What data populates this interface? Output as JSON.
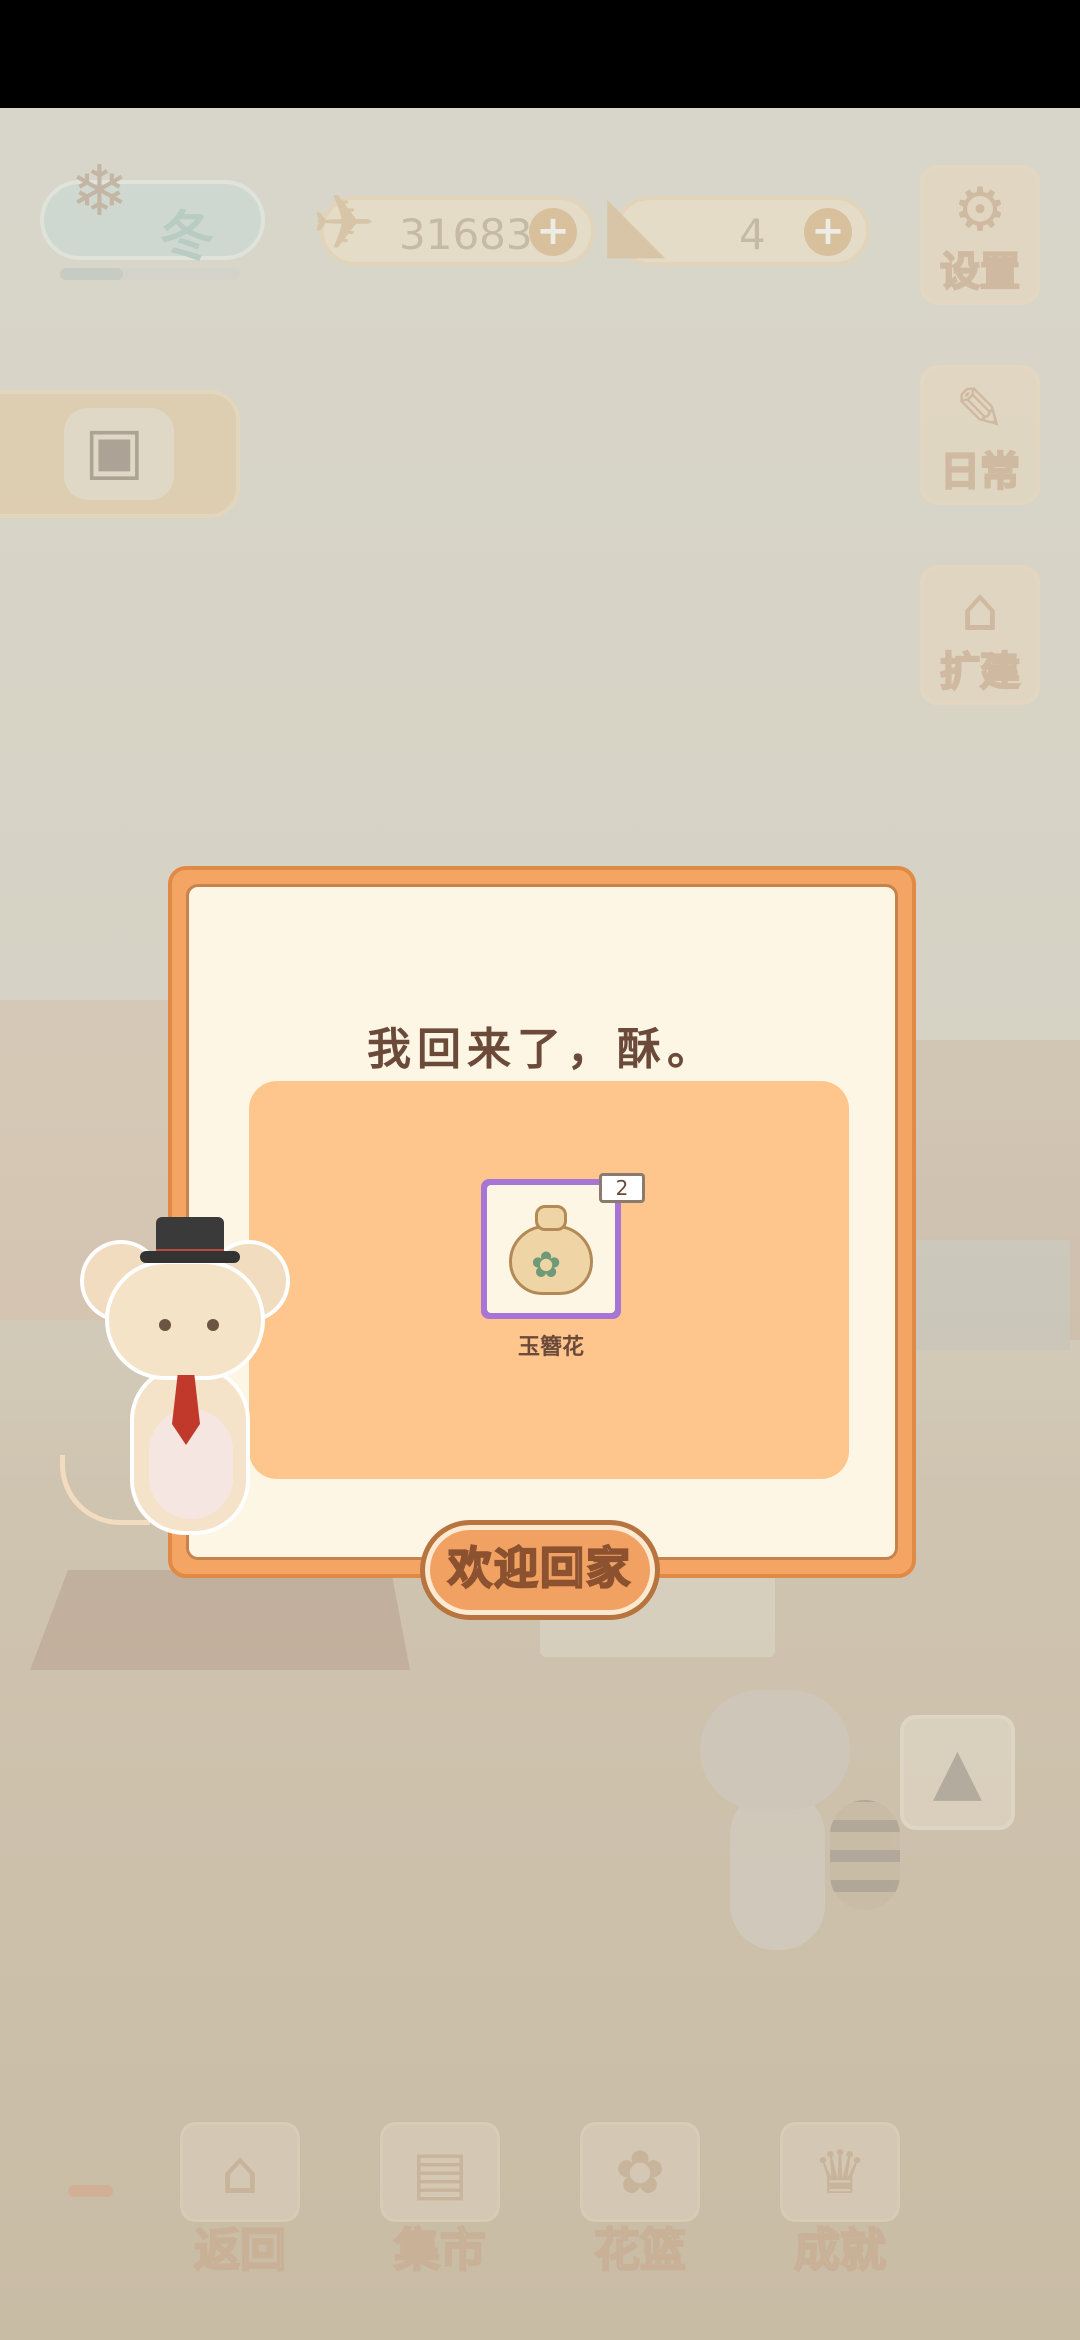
{
  "season": {
    "label": "冬",
    "progress": 0.35
  },
  "currencies": {
    "fish": "31683",
    "cheese": "4",
    "plus": "+"
  },
  "side_buttons": {
    "settings": "设置",
    "daily": "日常",
    "expand": "扩建"
  },
  "dialog": {
    "title": "我回来了，酥。",
    "reward": {
      "name": "玉簪花",
      "count": "2"
    },
    "confirm_label": "欢迎回家"
  },
  "bottom_nav": [
    {
      "label": "返回"
    },
    {
      "label": "集市"
    },
    {
      "label": "花篮"
    },
    {
      "label": "成就"
    }
  ],
  "icons": {
    "tree": "❄",
    "fish": "✈",
    "cheese": "◣",
    "settings": "⚙",
    "daily": "✎",
    "expand": "⌂",
    "bag": "▣",
    "map": "▲",
    "back": "⌂",
    "market": "▤",
    "basket": "✿",
    "achieve": "♛"
  },
  "colors": {
    "accent": "#f4a564",
    "panel": "#fec68d",
    "card": "#a675d6"
  }
}
